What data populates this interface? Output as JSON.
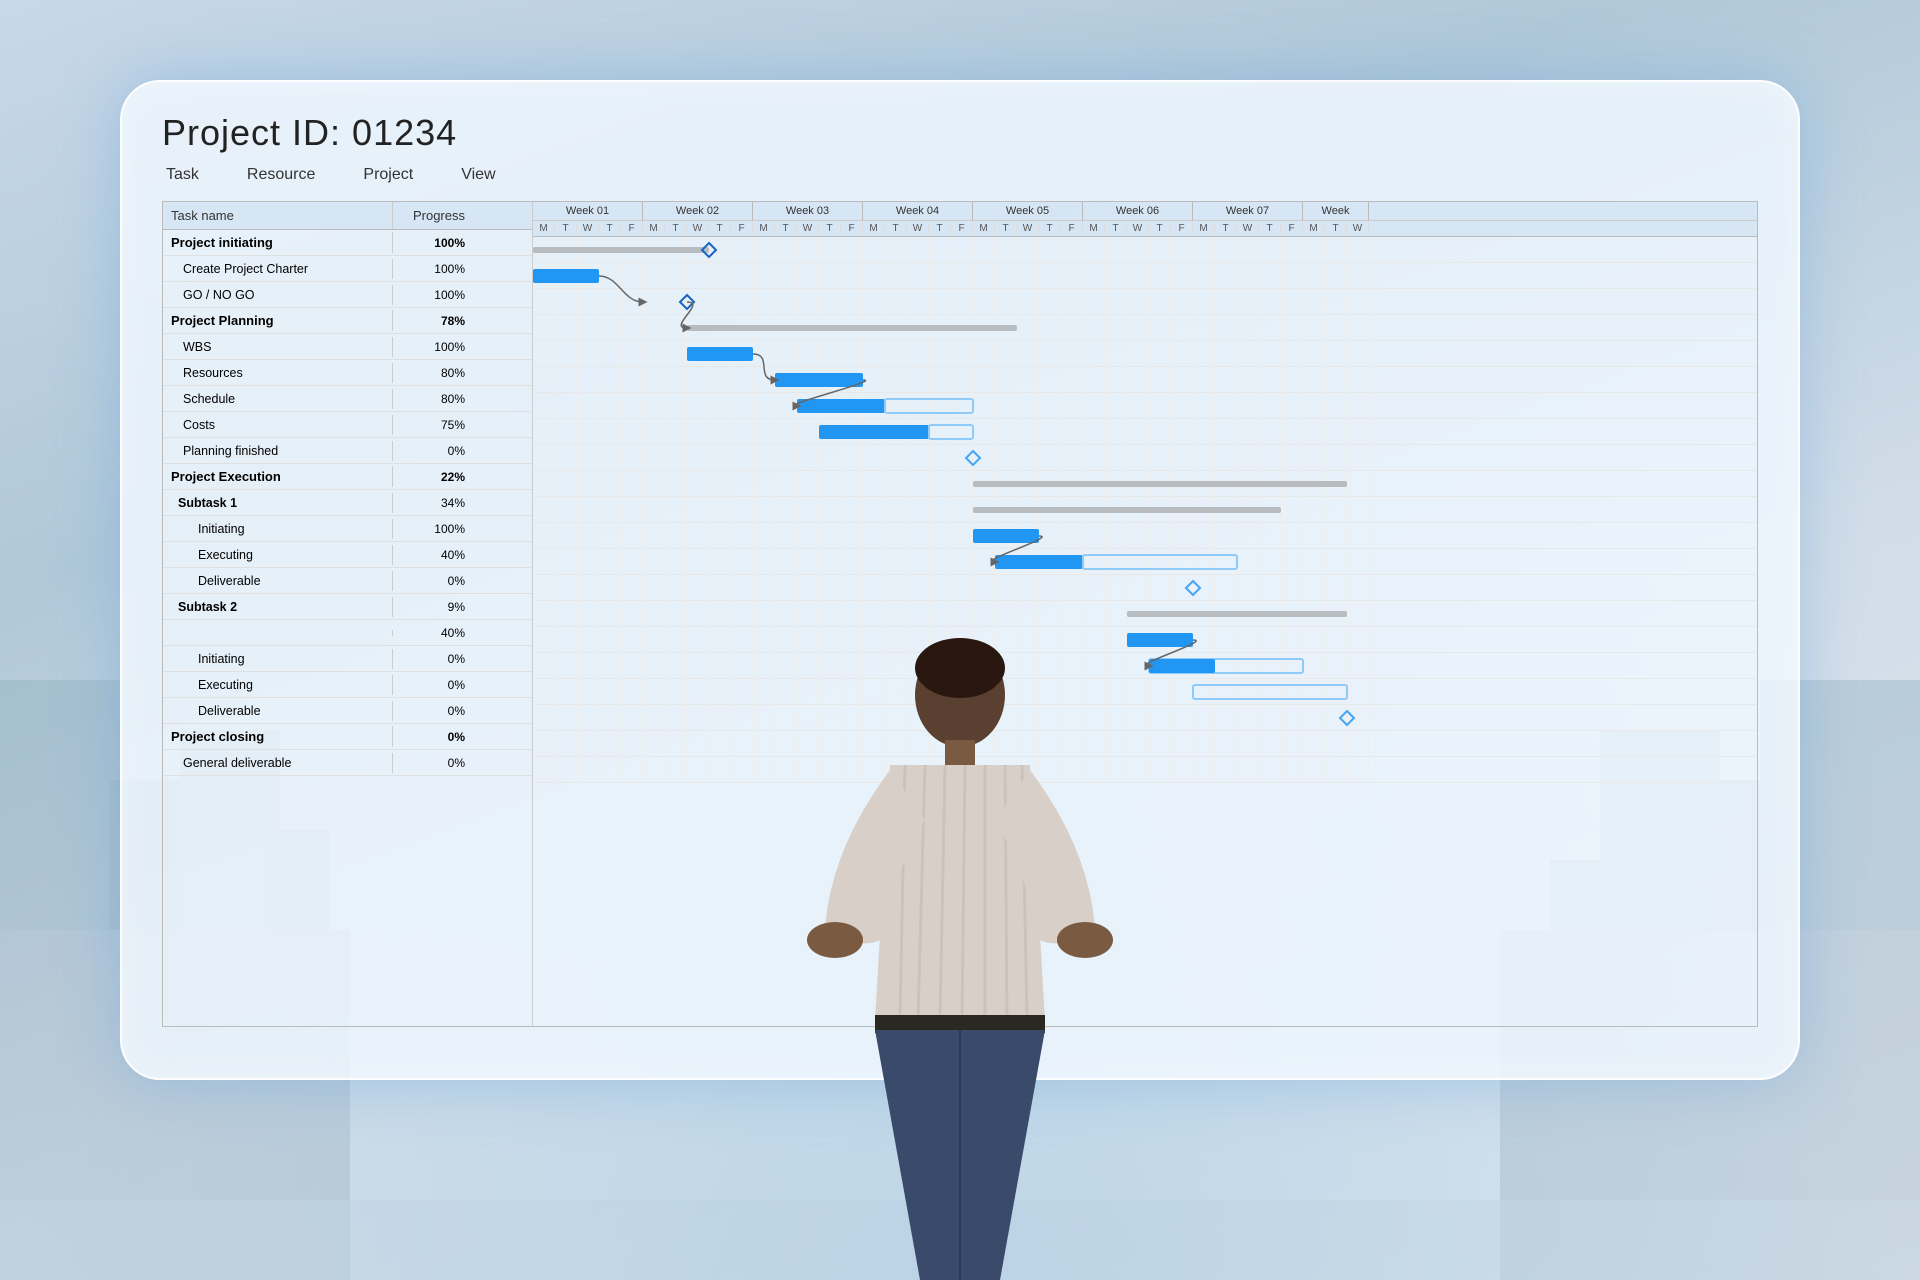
{
  "title": "Project ID: 01234",
  "menu": {
    "items": [
      "Task",
      "Resource",
      "Project",
      "View"
    ]
  },
  "table": {
    "headers": {
      "task_name": "Task name",
      "progress": "Progress"
    },
    "weeks": [
      "Week 01",
      "Week 02",
      "Week 03",
      "Week 04",
      "Week 05",
      "Week 06",
      "Week 07",
      "Week"
    ],
    "days": [
      "M",
      "T",
      "W",
      "T",
      "F",
      "M",
      "T",
      "W",
      "T",
      "F",
      "M",
      "T",
      "W",
      "T",
      "F",
      "M",
      "T",
      "W",
      "T",
      "F",
      "M",
      "T",
      "W",
      "T",
      "F",
      "M",
      "T",
      "W",
      "T",
      "F",
      "M",
      "T",
      "W",
      "T",
      "F",
      "M",
      "T",
      "W"
    ],
    "tasks": [
      {
        "name": "Project initiating",
        "progress": "100%",
        "type": "group",
        "indent": 0
      },
      {
        "name": "Create Project Charter",
        "progress": "100%",
        "type": "task",
        "indent": 1
      },
      {
        "name": "GO / NO GO",
        "progress": "100%",
        "type": "task",
        "indent": 1
      },
      {
        "name": "Project Planning",
        "progress": "78%",
        "type": "group",
        "indent": 0
      },
      {
        "name": "WBS",
        "progress": "100%",
        "type": "task",
        "indent": 1
      },
      {
        "name": "Resources",
        "progress": "80%",
        "type": "task",
        "indent": 1
      },
      {
        "name": "Schedule",
        "progress": "80%",
        "type": "task",
        "indent": 1
      },
      {
        "name": "Costs",
        "progress": "75%",
        "type": "task",
        "indent": 1
      },
      {
        "name": "Planning finished",
        "progress": "0%",
        "type": "task",
        "indent": 1
      },
      {
        "name": "Project Execution",
        "progress": "22%",
        "type": "group",
        "indent": 0
      },
      {
        "name": "Subtask 1",
        "progress": "34%",
        "type": "subgroup",
        "indent": 1
      },
      {
        "name": "Initiating",
        "progress": "100%",
        "type": "task",
        "indent": 2
      },
      {
        "name": "Executing",
        "progress": "40%",
        "type": "task",
        "indent": 2
      },
      {
        "name": "Deliverable",
        "progress": "0%",
        "type": "task",
        "indent": 2
      },
      {
        "name": "Subtask 2",
        "progress": "9%",
        "type": "subgroup",
        "indent": 1
      },
      {
        "name": "",
        "progress": "40%",
        "type": "task",
        "indent": 2
      },
      {
        "name": "Initiating",
        "progress": "0%",
        "type": "task",
        "indent": 2
      },
      {
        "name": "Executing",
        "progress": "0%",
        "type": "task",
        "indent": 2
      },
      {
        "name": "Deliverable",
        "progress": "0%",
        "type": "task",
        "indent": 2
      },
      {
        "name": "Project closing",
        "progress": "0%",
        "type": "group",
        "indent": 0
      },
      {
        "name": "General deliverable",
        "progress": "0%",
        "type": "task",
        "indent": 1
      }
    ]
  },
  "colors": {
    "bar_blue": "#2196F3",
    "bar_light_blue": "#90CAF9",
    "bar_gray": "#888888",
    "diamond_dark": "#1565C0",
    "diamond_light": "#42A5F5",
    "panel_bg": "rgba(240,248,255,0.82)"
  }
}
